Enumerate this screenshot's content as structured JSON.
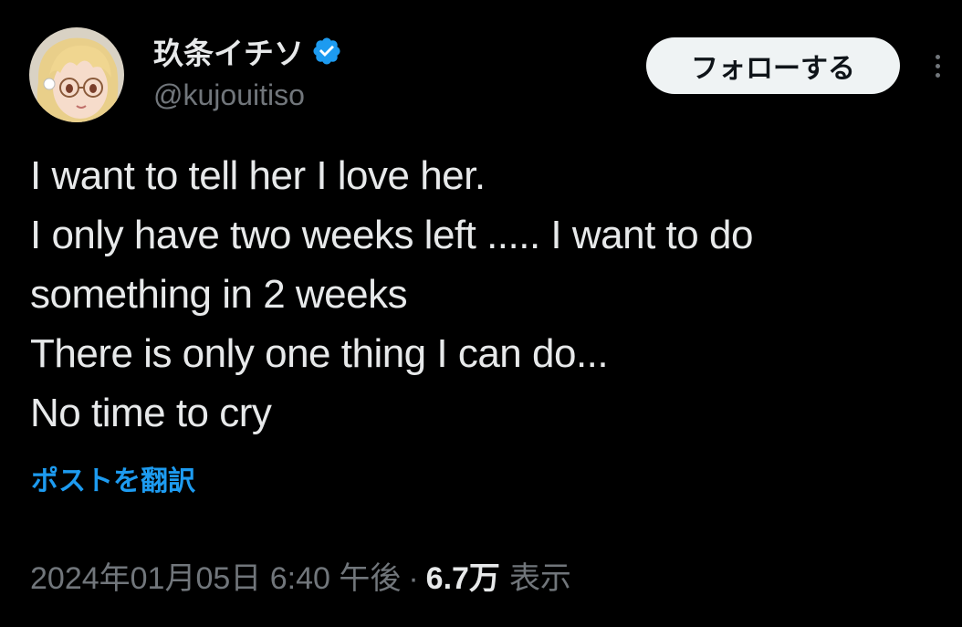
{
  "author": {
    "display_name": "玖条イチソ",
    "handle": "@kujouitiso",
    "verified_icon": "verified-badge-icon",
    "avatar_icon": "avatar"
  },
  "actions": {
    "follow_label": "フォローする",
    "more_icon": "more-icon"
  },
  "tweet": {
    "lines": [
      "I want to tell her I love her.",
      "I only have two weeks left ..... I want to do",
      "something in 2 weeks",
      "There is only one thing I can do...",
      "No time to cry"
    ],
    "translate_label": "ポストを翻訳"
  },
  "meta": {
    "timestamp": "2024年01月05日 6:40 午後",
    "separator": "·",
    "views_count": "6.7万",
    "views_label": "表示"
  },
  "colors": {
    "background": "#000000",
    "text_primary": "#e7e9ea",
    "text_secondary": "#71767b",
    "accent": "#1d9bf0",
    "follow_button_bg": "#eff3f4"
  }
}
